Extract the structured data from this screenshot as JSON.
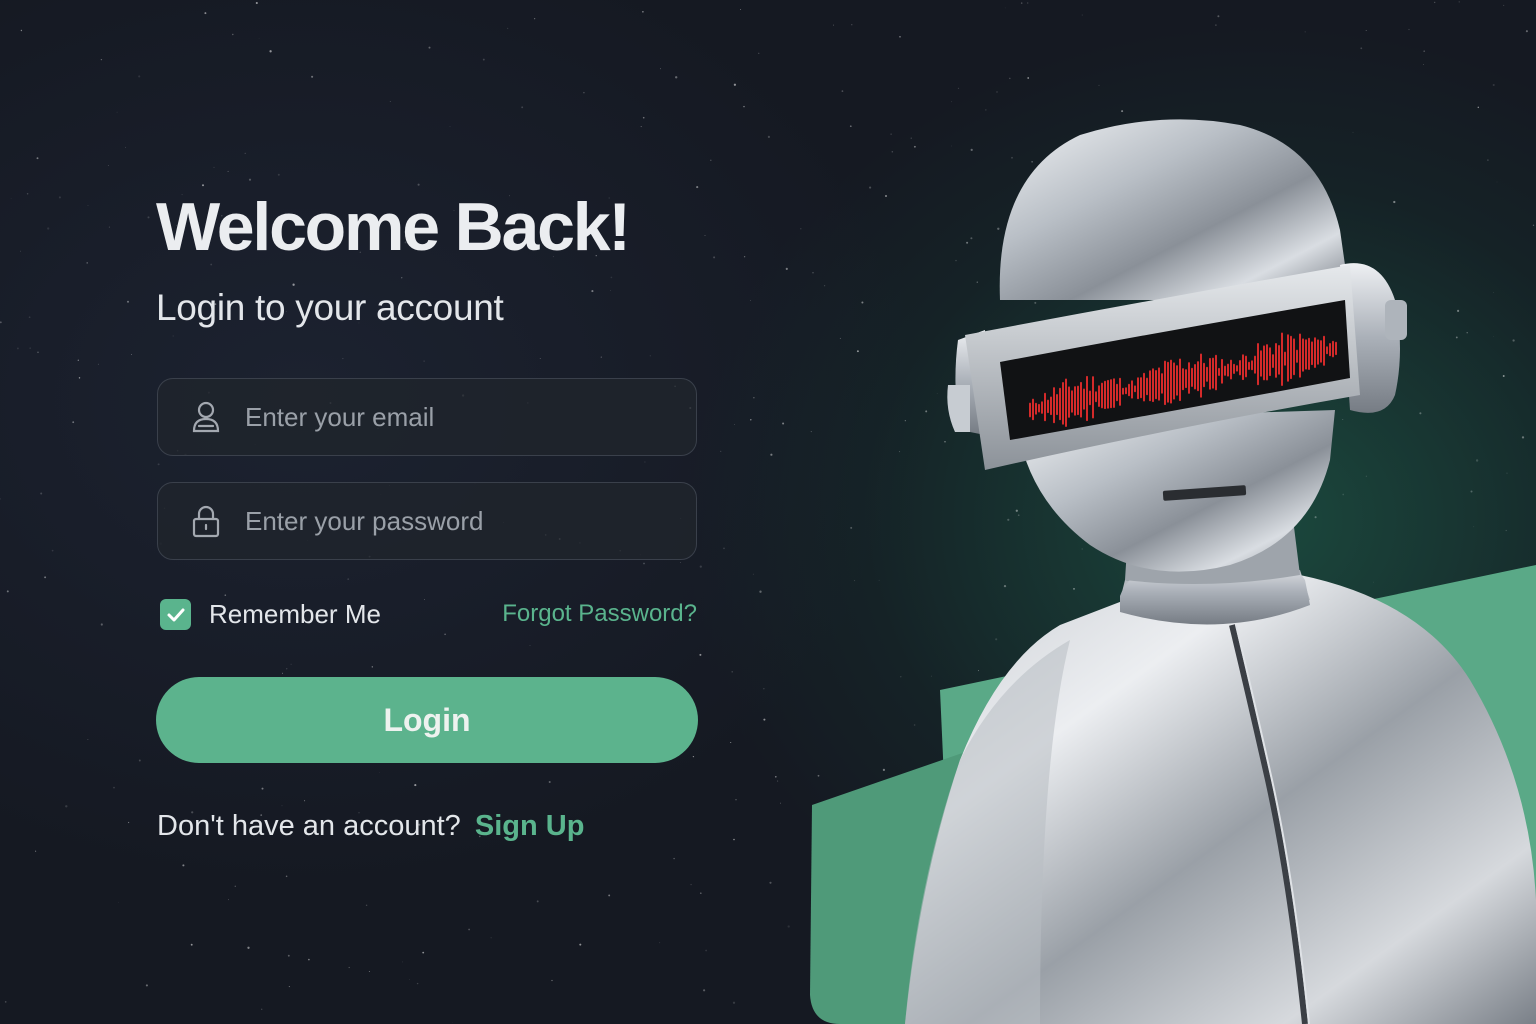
{
  "login": {
    "title": "Welcome Back!",
    "subtitle": "Login to your account",
    "email": {
      "placeholder": "Enter your email",
      "icon": "user-icon"
    },
    "password": {
      "placeholder": "Enter your password",
      "icon": "lock-icon"
    },
    "remember_me": {
      "label": "Remember Me",
      "checked": true
    },
    "forgot_password": "Forgot Password?",
    "submit_label": "Login",
    "signup_prompt": "Don't have an account?",
    "signup_link": "Sign Up"
  },
  "colors": {
    "accent": "#5cb38d",
    "background": "#151922",
    "field_background": "#20242c",
    "visor_wave": "#d42a2a"
  }
}
